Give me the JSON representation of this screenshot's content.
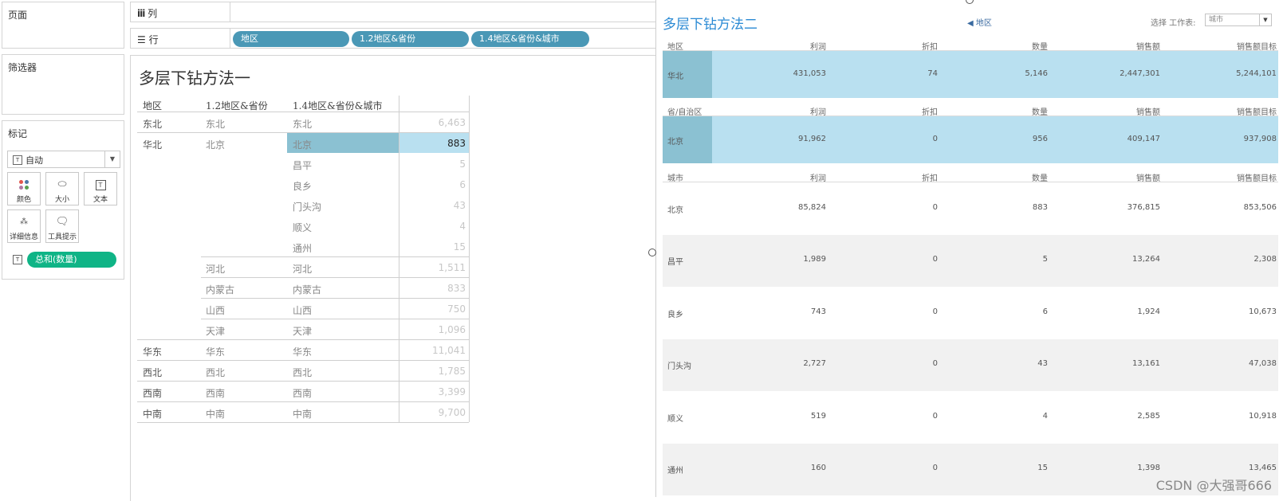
{
  "left_pane": {
    "pages_label": "页面",
    "filters_label": "筛选器",
    "marks_label": "标记",
    "mark_type": "自动",
    "mark_buttons": [
      {
        "label": "颜色",
        "icon": "color-dots-icon"
      },
      {
        "label": "大小",
        "icon": "size-icon"
      },
      {
        "label": "文本",
        "icon": "text-icon"
      },
      {
        "label": "详细信息",
        "icon": "detail-icon"
      },
      {
        "label": "工具提示",
        "icon": "tooltip-icon"
      }
    ],
    "measure_pill": "总和(数量)"
  },
  "shelves": {
    "columns_label": "列",
    "rows_label": "行",
    "row_pills": [
      "地区",
      "1.2地区&省份",
      "1.4地区&省份&城市"
    ]
  },
  "sheet1": {
    "title": "多层下钻方法一",
    "headers": [
      "地区",
      "1.2地区&省份",
      "1.4地区&省份&城市"
    ],
    "rows": [
      {
        "region": "东北",
        "province": "东北",
        "city": "东北",
        "value": "6,463"
      },
      {
        "region": "华北",
        "province": "北京",
        "city": "北京",
        "value": "883",
        "selected": true
      },
      {
        "region": "",
        "province": "",
        "city": "昌平",
        "value": "5"
      },
      {
        "region": "",
        "province": "",
        "city": "良乡",
        "value": "6"
      },
      {
        "region": "",
        "province": "",
        "city": "门头沟",
        "value": "43"
      },
      {
        "region": "",
        "province": "",
        "city": "顺义",
        "value": "4"
      },
      {
        "region": "",
        "province": "",
        "city": "通州",
        "value": "15"
      },
      {
        "region": "",
        "province": "河北",
        "city": "河北",
        "value": "1,511"
      },
      {
        "region": "",
        "province": "内蒙古",
        "city": "内蒙古",
        "value": "833"
      },
      {
        "region": "",
        "province": "山西",
        "city": "山西",
        "value": "750"
      },
      {
        "region": "",
        "province": "天津",
        "city": "天津",
        "value": "1,096"
      },
      {
        "region": "华东",
        "province": "华东",
        "city": "华东",
        "value": "11,041"
      },
      {
        "region": "西北",
        "province": "西北",
        "city": "西北",
        "value": "1,785"
      },
      {
        "region": "西南",
        "province": "西南",
        "city": "西南",
        "value": "3,399"
      },
      {
        "region": "中南",
        "province": "中南",
        "city": "中南",
        "value": "9,700"
      }
    ]
  },
  "sheet2": {
    "title": "多层下钻方法二",
    "back_link": "◀ 地区",
    "worksheet_label": "选择 工作表:",
    "worksheet_value": "城市",
    "measure_headers": [
      "利润",
      "折扣",
      "数量",
      "销售额",
      "销售额目标"
    ],
    "region_table": {
      "dim_header": "地区",
      "rows": [
        [
          "华北",
          "431,053",
          "74",
          "5,146",
          "2,447,301",
          "5,244,101"
        ]
      ]
    },
    "province_table": {
      "dim_header": "省/自治区",
      "rows": [
        [
          "北京",
          "91,962",
          "0",
          "956",
          "409,147",
          "937,908"
        ]
      ]
    },
    "city_table": {
      "dim_header": "城市",
      "rows": [
        [
          "北京",
          "85,824",
          "0",
          "883",
          "376,815",
          "853,506"
        ],
        [
          "昌平",
          "1,989",
          "0",
          "5",
          "13,264",
          "2,308"
        ],
        [
          "良乡",
          "743",
          "0",
          "6",
          "1,924",
          "10,673"
        ],
        [
          "门头沟",
          "2,727",
          "0",
          "43",
          "13,161",
          "47,038"
        ],
        [
          "顺义",
          "519",
          "0",
          "4",
          "2,585",
          "10,918"
        ],
        [
          "通州",
          "160",
          "0",
          "15",
          "1,398",
          "13,465"
        ]
      ]
    }
  },
  "watermark": "CSDN @大强哥666",
  "colors": {
    "pill_blue": "#4a98b6",
    "pill_green": "#0fb486",
    "selection_light": "#b9e0f0",
    "selection_dark": "#8bc1d2",
    "title_blue": "#2a8ad4"
  }
}
